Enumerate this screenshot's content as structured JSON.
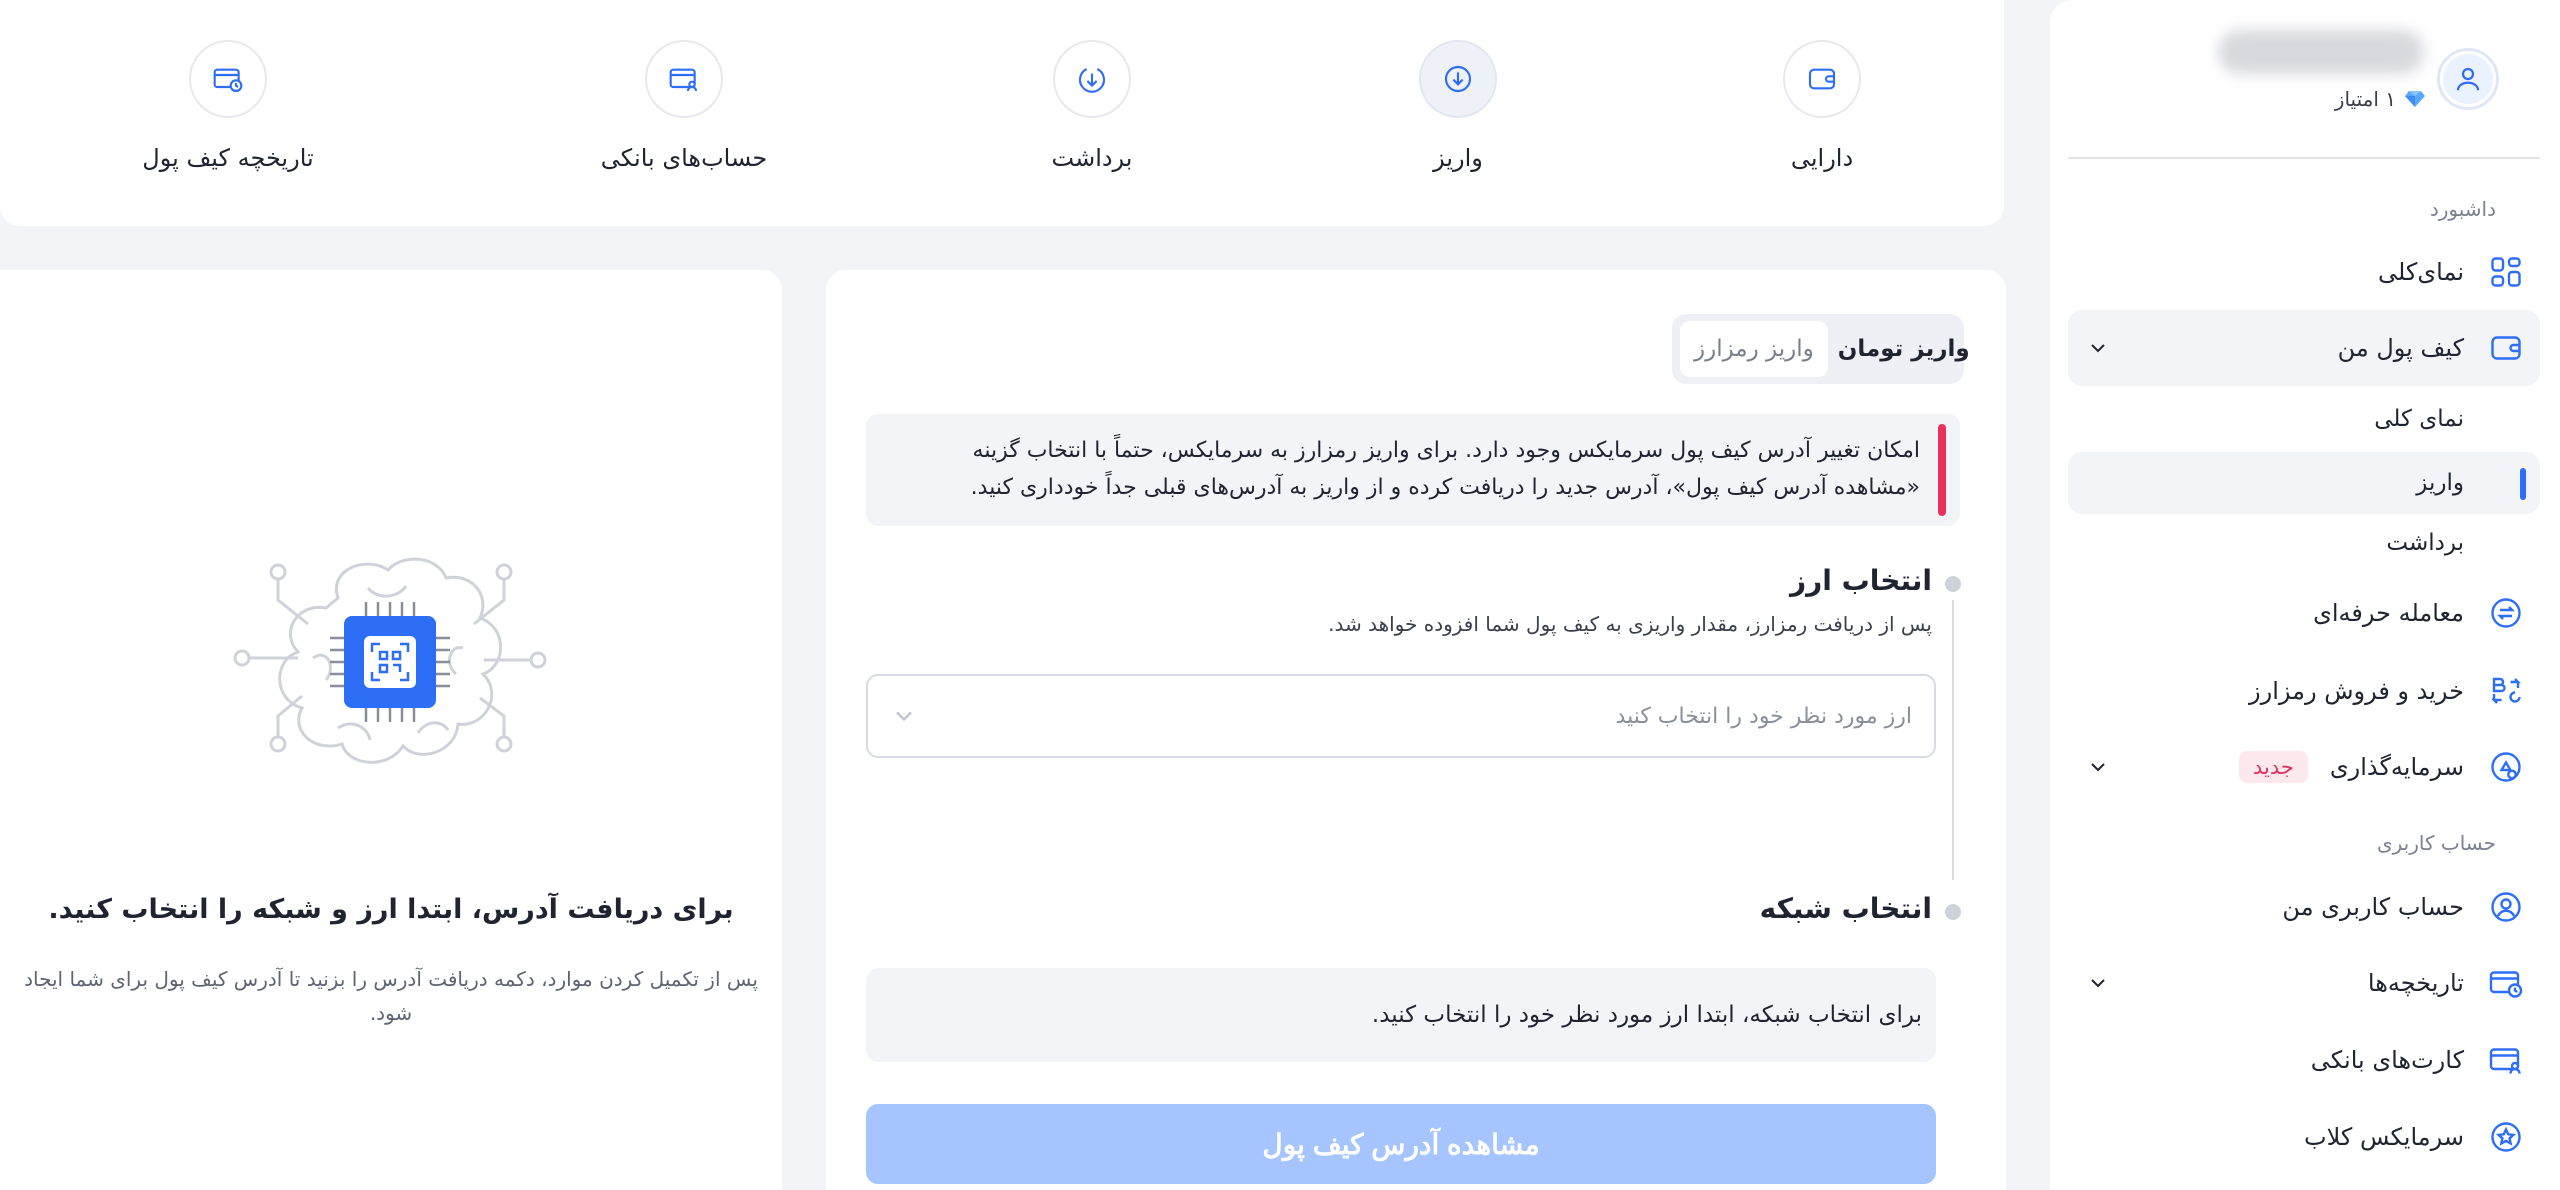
{
  "sidebar": {
    "user": {
      "points": "۱ امتیاز"
    },
    "sections": {
      "dashboard": "داشبورد",
      "account": "حساب کاربری"
    },
    "items": [
      {
        "label": "نمای‌کلی",
        "icon": "grid-icon"
      },
      {
        "label": "کیف پول من",
        "icon": "wallet-icon"
      },
      {
        "label": "معامله حرفه‌ای",
        "icon": "exchange-icon"
      },
      {
        "label": "خرید و فروش رمزارز",
        "icon": "currency-swap-icon"
      },
      {
        "label": "سرمایه‌گذاری",
        "icon": "investment-icon",
        "badge": "جدید"
      },
      {
        "label": "حساب کاربری من",
        "icon": "user-icon"
      },
      {
        "label": "تاریخچه‌ها",
        "icon": "history-icon"
      },
      {
        "label": "کارت‌های بانکی",
        "icon": "bank-card-icon"
      },
      {
        "label": "سرمایکس کلاب",
        "icon": "star-icon"
      }
    ],
    "wallet_sub": [
      {
        "label": "نمای کلی"
      },
      {
        "label": "واریز"
      },
      {
        "label": "برداشت"
      }
    ]
  },
  "top_tabs": [
    {
      "label": "دارایی",
      "icon": "wallet-icon"
    },
    {
      "label": "واریز",
      "icon": "deposit-icon"
    },
    {
      "label": "برداشت",
      "icon": "withdraw-icon"
    },
    {
      "label": "حساب‌های بانکی",
      "icon": "bank-account-icon"
    },
    {
      "label": "تاریخچه کیف پول",
      "icon": "wallet-history-icon"
    }
  ],
  "deposit": {
    "tabs": {
      "toman": "واریز تومان",
      "crypto": "واریز رمزارز"
    },
    "alert": "امکان تغییر آدرس کیف پول سرمایکس وجود دارد. برای واریز رمزارز به سرمایکس، حتماً با انتخاب گزینه «مشاهده آدرس کیف پول»، آدرس جدید را دریافت کرده و از واریز به آدرس‌های قبلی جداً خودداری کنید.",
    "step1_title": "انتخاب ارز",
    "step1_desc": "پس از دریافت رمزارز، مقدار واریزی به کیف پول شما افزوده خواهد شد.",
    "select_placeholder": "ارز مورد نظر خود را انتخاب کنید",
    "step2_title": "انتخاب شبکه",
    "network_hint": "برای انتخاب شبکه، ابتدا ارز مورد نظر خود را انتخاب کنید.",
    "button": "مشاهده آدرس کیف پول"
  },
  "illustration": {
    "title": "برای دریافت آدرس، ابتدا ارز و شبکه را انتخاب کنید.",
    "desc": "پس از تکمیل کردن موارد، دکمه دریافت آدرس را بزنید تا آدرس کیف پول برای شما ایجاد شود."
  },
  "colors": {
    "accent": "#2e6ef6",
    "alert": "#e8305c",
    "button_disabled": "#a6c4ff",
    "badge": "#e1345f"
  }
}
